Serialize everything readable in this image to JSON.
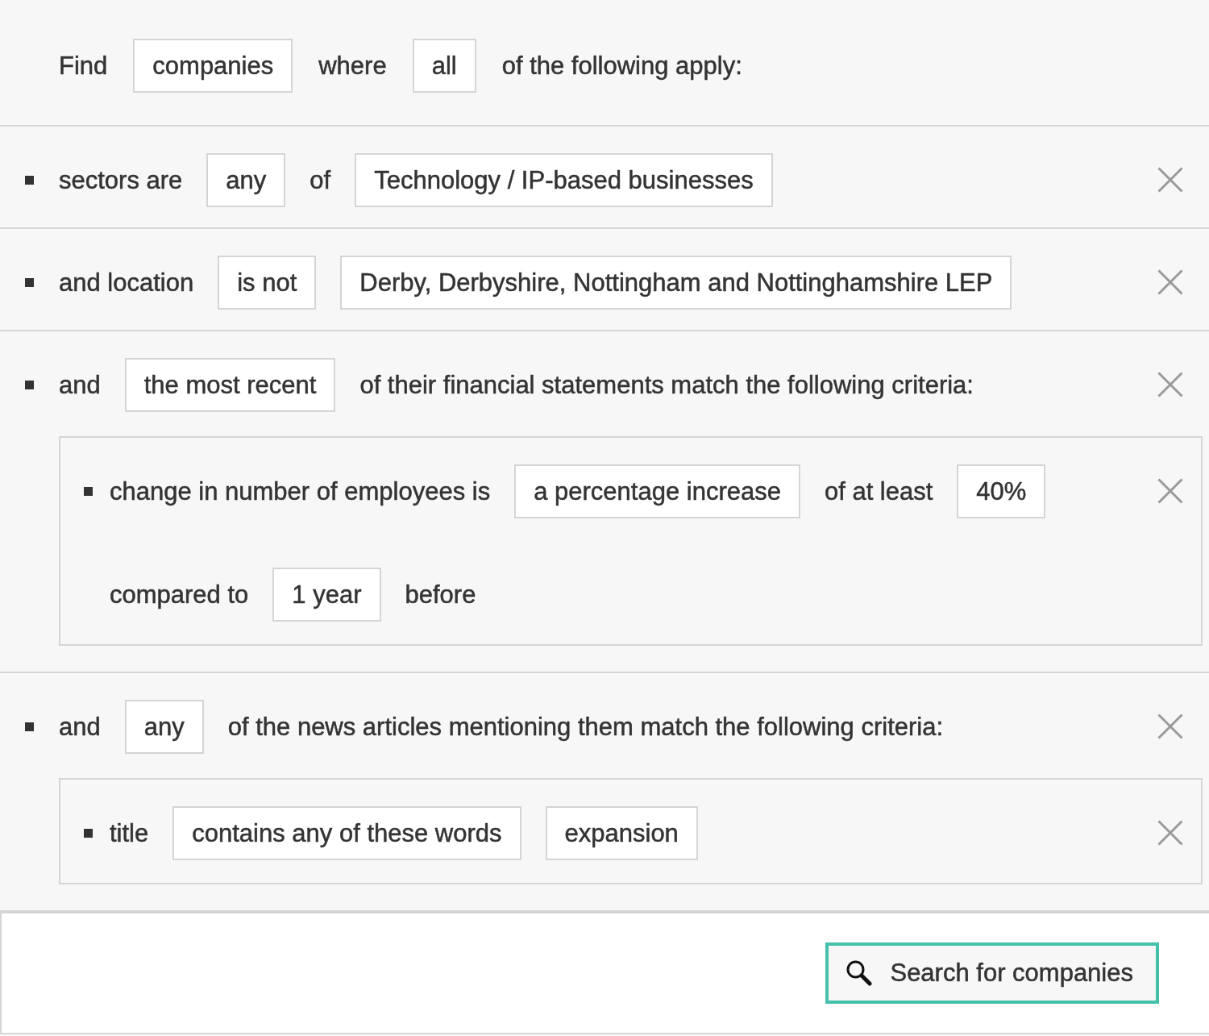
{
  "query": {
    "tokens": [
      {
        "kind": "text",
        "text": "Find"
      },
      {
        "kind": "select",
        "text": "companies"
      },
      {
        "kind": "text",
        "text": "where"
      },
      {
        "kind": "select",
        "text": "all"
      },
      {
        "kind": "text",
        "text": "of the following apply:"
      }
    ]
  },
  "rules": [
    {
      "lines": [
        [
          {
            "kind": "text",
            "text": "sectors are"
          },
          {
            "kind": "select",
            "text": "any"
          },
          {
            "kind": "text",
            "text": "of"
          },
          {
            "kind": "select",
            "text": "Technology / IP-based businesses"
          }
        ]
      ]
    },
    {
      "lines": [
        [
          {
            "kind": "text",
            "text": "and location"
          },
          {
            "kind": "select",
            "text": "is not"
          },
          {
            "kind": "select",
            "text": "Derby, Derbyshire, Nottingham and Nottinghamshire LEP"
          }
        ]
      ]
    },
    {
      "lines": [
        [
          {
            "kind": "text",
            "text": "and"
          },
          {
            "kind": "select",
            "text": "the most recent"
          },
          {
            "kind": "text",
            "text": "of their financial statements match the following criteria:"
          }
        ]
      ],
      "children": [
        {
          "lines": [
            [
              {
                "kind": "text",
                "text": "change in number of employees is"
              },
              {
                "kind": "select",
                "text": "a percentage increase"
              },
              {
                "kind": "text",
                "text": "of at least"
              },
              {
                "kind": "input",
                "text": "40%"
              }
            ],
            [
              {
                "kind": "text",
                "text": "compared to"
              },
              {
                "kind": "select",
                "text": "1 year"
              },
              {
                "kind": "text",
                "text": "before"
              }
            ]
          ]
        }
      ]
    },
    {
      "lines": [
        [
          {
            "kind": "text",
            "text": "and"
          },
          {
            "kind": "select",
            "text": "any"
          },
          {
            "kind": "text",
            "text": "of the news articles mentioning them match the following criteria:"
          }
        ]
      ],
      "children": [
        {
          "lines": [
            [
              {
                "kind": "text",
                "text": "title"
              },
              {
                "kind": "select",
                "text": "contains any of these words"
              },
              {
                "kind": "input",
                "text": "expansion"
              }
            ]
          ]
        }
      ]
    }
  ],
  "search_button": {
    "label": "Search for companies"
  }
}
